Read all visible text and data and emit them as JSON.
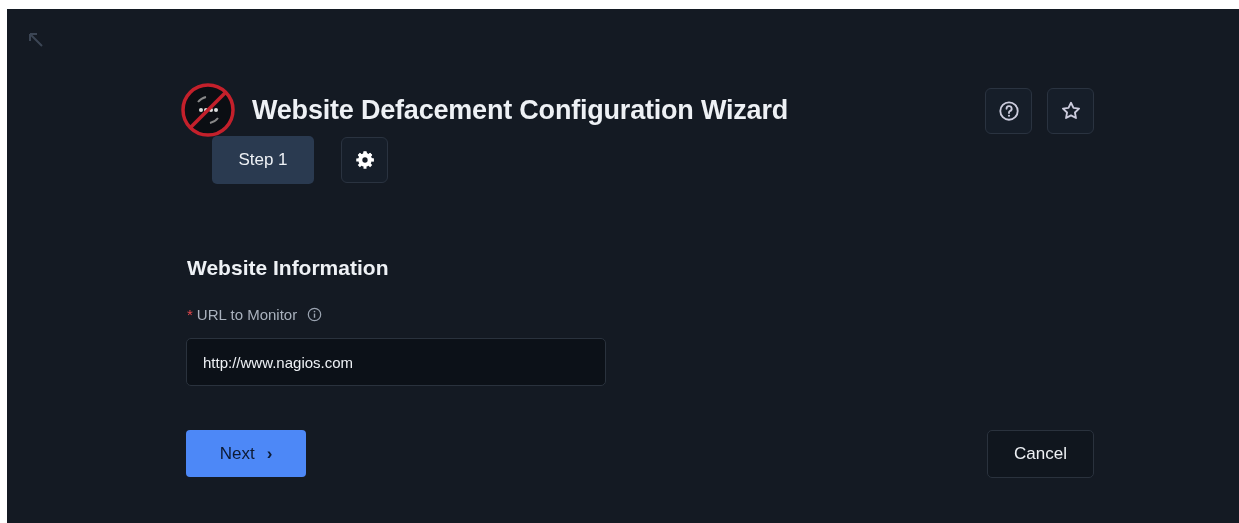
{
  "header": {
    "title": "Website Defacement Configuration Wizard",
    "step": "Step 1"
  },
  "section": {
    "title": "Website Information"
  },
  "fields": [
    {
      "label": "URL to Monitor",
      "required": true,
      "required_mark": "*",
      "value": "http://www.nagios.com"
    }
  ],
  "buttons": {
    "next": "Next",
    "next_glyph": "›",
    "cancel": "Cancel"
  }
}
